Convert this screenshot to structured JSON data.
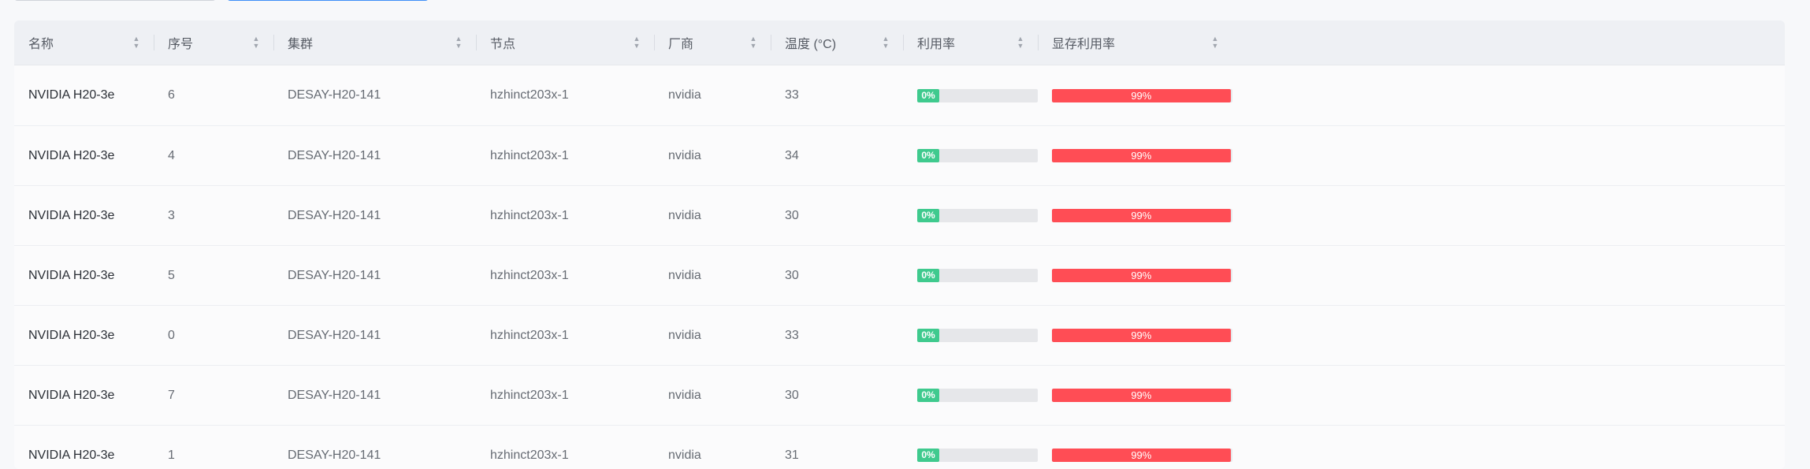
{
  "table": {
    "columns": [
      {
        "key": "name",
        "label": "名称"
      },
      {
        "key": "index",
        "label": "序号"
      },
      {
        "key": "cluster",
        "label": "集群"
      },
      {
        "key": "node",
        "label": "节点"
      },
      {
        "key": "vendor",
        "label": "厂商"
      },
      {
        "key": "temperature",
        "label": "温度 (°C)"
      },
      {
        "key": "utilization",
        "label": "利用率"
      },
      {
        "key": "memory_utilization",
        "label": "显存利用率"
      }
    ],
    "sort_icon": "sort-caret-icon",
    "rows": [
      {
        "name": "NVIDIA H20-3e",
        "index": "6",
        "cluster": "DESAY-H20-141",
        "node": "hzhinct203x-1",
        "vendor": "nvidia",
        "temperature": "33",
        "utilization": "0%",
        "utilization_value": 0,
        "memory_utilization": "99%",
        "memory_value": 99
      },
      {
        "name": "NVIDIA H20-3e",
        "index": "4",
        "cluster": "DESAY-H20-141",
        "node": "hzhinct203x-1",
        "vendor": "nvidia",
        "temperature": "34",
        "utilization": "0%",
        "utilization_value": 0,
        "memory_utilization": "99%",
        "memory_value": 99
      },
      {
        "name": "NVIDIA H20-3e",
        "index": "3",
        "cluster": "DESAY-H20-141",
        "node": "hzhinct203x-1",
        "vendor": "nvidia",
        "temperature": "30",
        "utilization": "0%",
        "utilization_value": 0,
        "memory_utilization": "99%",
        "memory_value": 99
      },
      {
        "name": "NVIDIA H20-3e",
        "index": "5",
        "cluster": "DESAY-H20-141",
        "node": "hzhinct203x-1",
        "vendor": "nvidia",
        "temperature": "30",
        "utilization": "0%",
        "utilization_value": 0,
        "memory_utilization": "99%",
        "memory_value": 99
      },
      {
        "name": "NVIDIA H20-3e",
        "index": "0",
        "cluster": "DESAY-H20-141",
        "node": "hzhinct203x-1",
        "vendor": "nvidia",
        "temperature": "33",
        "utilization": "0%",
        "utilization_value": 0,
        "memory_utilization": "99%",
        "memory_value": 99
      },
      {
        "name": "NVIDIA H20-3e",
        "index": "7",
        "cluster": "DESAY-H20-141",
        "node": "hzhinct203x-1",
        "vendor": "nvidia",
        "temperature": "30",
        "utilization": "0%",
        "utilization_value": 0,
        "memory_utilization": "99%",
        "memory_value": 99
      },
      {
        "name": "NVIDIA H20-3e",
        "index": "1",
        "cluster": "DESAY-H20-141",
        "node": "hzhinct203x-1",
        "vendor": "nvidia",
        "temperature": "31",
        "utilization": "0%",
        "utilization_value": 0,
        "memory_utilization": "99%",
        "memory_value": 99
      }
    ]
  },
  "colors": {
    "utilization_bar": "#3fca8e",
    "memory_bar": "#ff4d55",
    "track": "#e6e7ea"
  }
}
